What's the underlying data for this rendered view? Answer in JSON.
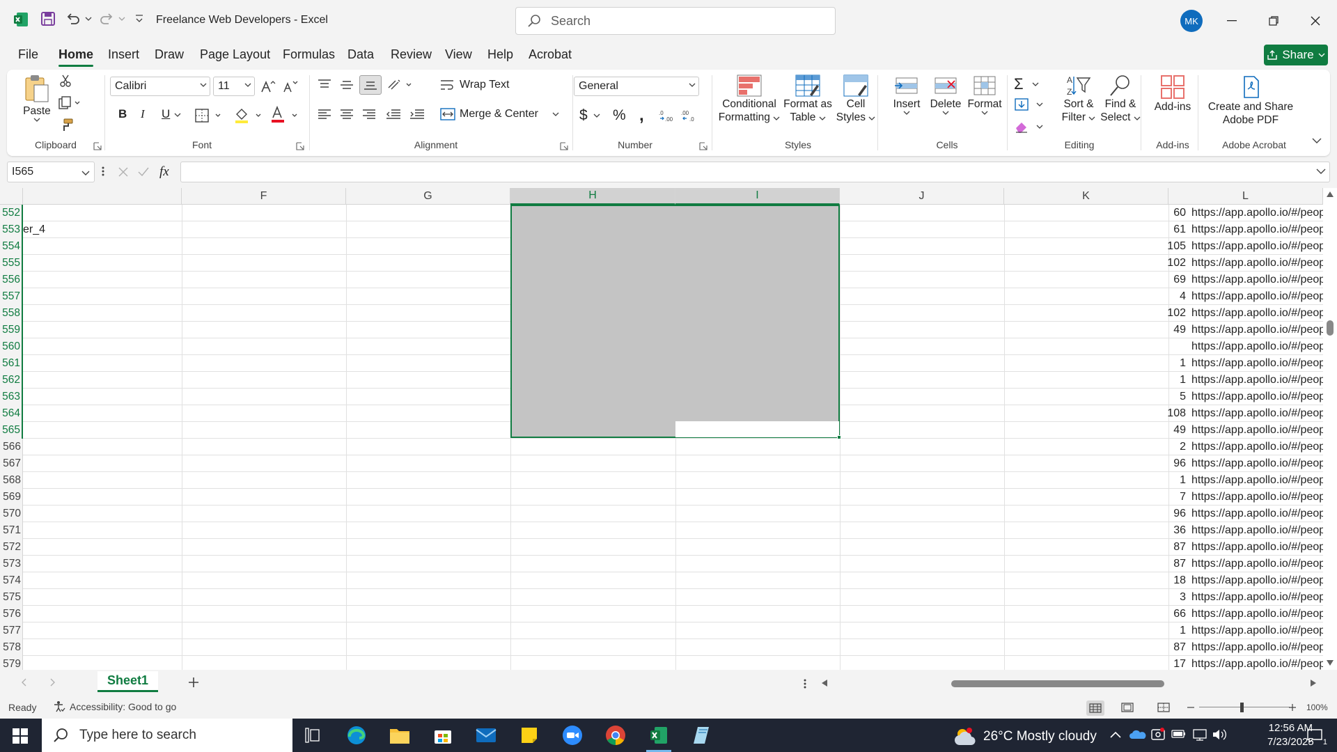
{
  "window": {
    "title": "Freelance Web Developers  -  Excel",
    "search_placeholder": "Search",
    "user_initials": "MK"
  },
  "tabs": [
    "File",
    "Home",
    "Insert",
    "Draw",
    "Page Layout",
    "Formulas",
    "Data",
    "Review",
    "View",
    "Help",
    "Acrobat"
  ],
  "active_tab": "Home",
  "share_label": "Share",
  "ribbon": {
    "clipboard": {
      "group": "Clipboard",
      "paste": "Paste"
    },
    "font": {
      "group": "Font",
      "family": "Calibri",
      "size": "11"
    },
    "alignment": {
      "group": "Alignment",
      "wrap_text": "Wrap Text",
      "merge_center": "Merge & Center"
    },
    "number": {
      "group": "Number",
      "format": "General"
    },
    "styles": {
      "group": "Styles",
      "conditional_1": "Conditional",
      "conditional_2": "Formatting",
      "format_table_1": "Format as",
      "format_table_2": "Table",
      "cell_styles_1": "Cell",
      "cell_styles_2": "Styles"
    },
    "cells": {
      "group": "Cells",
      "insert": "Insert",
      "delete": "Delete",
      "format": "Format"
    },
    "editing": {
      "group": "Editing",
      "sort_1": "Sort &",
      "sort_2": "Filter",
      "find_1": "Find &",
      "find_2": "Select"
    },
    "addins": {
      "group": "Add-ins",
      "label": "Add-ins"
    },
    "acrobat": {
      "group": "Adobe Acrobat",
      "label_1": "Create and Share",
      "label_2": "Adobe PDF"
    }
  },
  "formula_bar": {
    "name_box": "I565",
    "fx": "fx",
    "value": ""
  },
  "columns": [
    "F",
    "G",
    "H",
    "I",
    "J",
    "K",
    "L"
  ],
  "selected_columns": [
    "H",
    "I"
  ],
  "rows": [
    {
      "num": "552",
      "e": "",
      "k": "60",
      "l": "https://app.apollo.io/#/peop"
    },
    {
      "num": "553",
      "e": "er_4",
      "k": "61",
      "l": "https://app.apollo.io/#/peop"
    },
    {
      "num": "554",
      "e": "",
      "k": "105",
      "l": "https://app.apollo.io/#/peop"
    },
    {
      "num": "555",
      "e": "",
      "k": "102",
      "l": "https://app.apollo.io/#/peop"
    },
    {
      "num": "556",
      "e": "",
      "k": "69",
      "l": "https://app.apollo.io/#/peop"
    },
    {
      "num": "557",
      "e": "",
      "k": "4",
      "l": "https://app.apollo.io/#/peop"
    },
    {
      "num": "558",
      "e": "",
      "k": "102",
      "l": "https://app.apollo.io/#/peop"
    },
    {
      "num": "559",
      "e": "",
      "k": "49",
      "l": "https://app.apollo.io/#/peop"
    },
    {
      "num": "560",
      "e": "",
      "k": "",
      "l": "https://app.apollo.io/#/peop"
    },
    {
      "num": "561",
      "e": "",
      "k": "1",
      "l": "https://app.apollo.io/#/peop"
    },
    {
      "num": "562",
      "e": "",
      "k": "1",
      "l": "https://app.apollo.io/#/peop"
    },
    {
      "num": "563",
      "e": "",
      "k": "5",
      "l": "https://app.apollo.io/#/peop"
    },
    {
      "num": "564",
      "e": "",
      "k": "108",
      "l": "https://app.apollo.io/#/peop"
    },
    {
      "num": "565",
      "e": "",
      "k": "49",
      "l": "https://app.apollo.io/#/peop"
    },
    {
      "num": "566",
      "e": "",
      "k": "2",
      "l": "https://app.apollo.io/#/peop"
    },
    {
      "num": "567",
      "e": "",
      "k": "96",
      "l": "https://app.apollo.io/#/peop"
    },
    {
      "num": "568",
      "e": "",
      "k": "1",
      "l": "https://app.apollo.io/#/peop"
    },
    {
      "num": "569",
      "e": "",
      "k": "7",
      "l": "https://app.apollo.io/#/peop"
    },
    {
      "num": "570",
      "e": "",
      "k": "96",
      "l": "https://app.apollo.io/#/peop"
    },
    {
      "num": "571",
      "e": "",
      "k": "36",
      "l": "https://app.apollo.io/#/peop"
    },
    {
      "num": "572",
      "e": "",
      "k": "87",
      "l": "https://app.apollo.io/#/peop"
    },
    {
      "num": "573",
      "e": "",
      "k": "87",
      "l": "https://app.apollo.io/#/peop"
    },
    {
      "num": "574",
      "e": "",
      "k": "18",
      "l": "https://app.apollo.io/#/peop"
    },
    {
      "num": "575",
      "e": "",
      "k": "3",
      "l": "https://app.apollo.io/#/peop"
    },
    {
      "num": "576",
      "e": "",
      "k": "66",
      "l": "https://app.apollo.io/#/peop"
    },
    {
      "num": "577",
      "e": "",
      "k": "1",
      "l": "https://app.apollo.io/#/peop"
    },
    {
      "num": "578",
      "e": "",
      "k": "87",
      "l": "https://app.apollo.io/#/peop"
    },
    {
      "num": "579",
      "e": "",
      "k": "17",
      "l": "https://app.apollo.io/#/peop"
    }
  ],
  "selected_rows": [
    "552",
    "553",
    "554",
    "555",
    "556",
    "557",
    "558",
    "559",
    "560",
    "561",
    "562",
    "563",
    "564",
    "565"
  ],
  "sheet_tab": "Sheet1",
  "status": {
    "ready": "Ready",
    "accessibility": "Accessibility: Good to go",
    "zoom": "100%"
  },
  "taskbar": {
    "search_placeholder": "Type here to search",
    "weather": "26°C  Mostly cloudy",
    "time": "12:56 AM",
    "date": "7/23/2025",
    "notifications": "1"
  },
  "colors": {
    "accent": "#107c41",
    "selection": "#c4c4c4",
    "taskbar": "#1f2533"
  }
}
